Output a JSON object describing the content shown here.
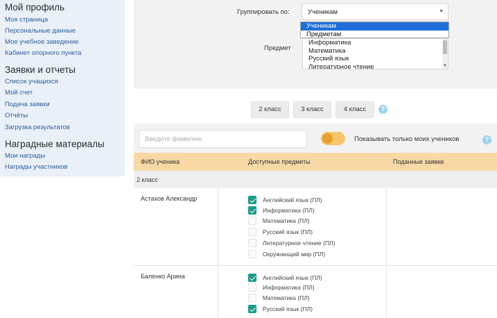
{
  "sidebar": {
    "sections": [
      {
        "title": "Мой профиль",
        "items": [
          "Моя страница",
          "Персональные данные",
          "Мое учебное заведение",
          "Кабинет опорного пункта"
        ]
      },
      {
        "title": "Заявки и отчеты",
        "items": [
          "Список учащихся",
          "Мой счет",
          "Подача заявки",
          "Отчёты",
          "Загрузка результатов"
        ]
      },
      {
        "title": "Наградные материалы",
        "items": [
          "Мои награды",
          "Награды участников"
        ]
      }
    ]
  },
  "filters": {
    "group_label": "Группировать по:",
    "group_value": "Ученикам",
    "group_options": [
      {
        "label": "Ученикам",
        "selected": true
      },
      {
        "label": "Предметам",
        "selected": false
      }
    ],
    "subject_label": "Предмет",
    "subjects": [
      "Информатика",
      "Математика",
      "Русский язык",
      "Литературное чтение"
    ]
  },
  "grades": [
    "2 класс",
    "3 класс",
    "4 класс"
  ],
  "search": {
    "placeholder": "Введите фамилию"
  },
  "toggle": {
    "label": "Показывать только моих учеников",
    "on": false
  },
  "table": {
    "headers": [
      "ФИО ученика",
      "Доступные предметы",
      "Поданные заявки"
    ],
    "group": "2 класс",
    "students": [
      {
        "name": "Астахов Александр",
        "subjects": [
          {
            "label": "Английский язык (ПЛ)",
            "checked": true
          },
          {
            "label": "Информатика (ПЛ)",
            "checked": true
          },
          {
            "label": "Математика (ПЛ)",
            "checked": false
          },
          {
            "label": "Русский язык (ПЛ)",
            "checked": false
          },
          {
            "label": "Литературное чтение (ПЛ)",
            "checked": false
          },
          {
            "label": "Окружающий мир (ПЛ)",
            "checked": false
          }
        ]
      },
      {
        "name": "Баленко Арина",
        "subjects": [
          {
            "label": "Английский язык (ПЛ)",
            "checked": true
          },
          {
            "label": "Информатика (ПЛ)",
            "checked": false
          },
          {
            "label": "Математика (ПЛ)",
            "checked": false
          },
          {
            "label": "Русский язык (ПЛ)",
            "checked": true
          }
        ]
      }
    ]
  },
  "colors": {
    "accent": "#1a9c8c",
    "header_bg": "#f8d9a6",
    "toggle": "#e8a12e",
    "link": "#2f5f9e"
  }
}
